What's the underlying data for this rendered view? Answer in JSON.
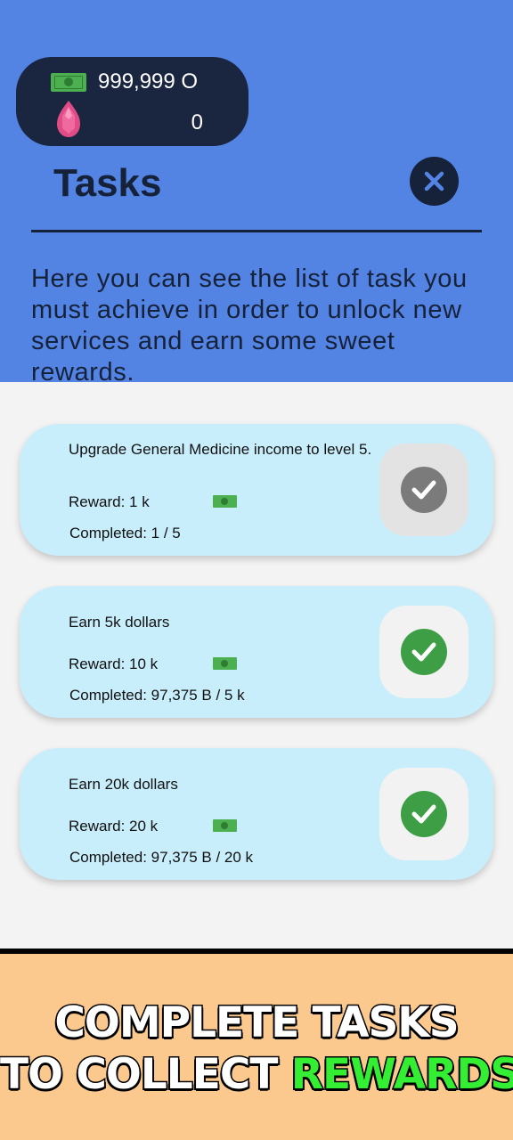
{
  "currency": {
    "cash": "999,999 O",
    "gems": "0"
  },
  "header": {
    "title": "Tasks",
    "description": "Here you can see the list of task you must achieve in order to unlock new services and earn some sweet rewards."
  },
  "tasks": [
    {
      "title": "Upgrade General Medicine income to level 5.",
      "reward": "Reward: 1 k",
      "completed": "Completed:  1 / 5",
      "status": "pending"
    },
    {
      "title": "Earn 5k dollars",
      "reward": "Reward: 10 k",
      "completed": "Completed:  97,375 B / 5 k",
      "status": "done"
    },
    {
      "title": "Earn 20k dollars",
      "reward": "Reward: 20 k",
      "completed": "Completed:  97,375 B / 20 k",
      "status": "done"
    }
  ],
  "banner": {
    "line1": "COMPLETE TASKS",
    "line2_part1": "TO COLLECT",
    "line2_part2": "REWARDS"
  },
  "colors": {
    "header_bg": "#5384e3",
    "panel_bg": "#1a2540",
    "card_bg": "#c9eefb",
    "done_check": "#3e9e45",
    "pending_check": "#7b7b7b",
    "banner_bg": "#fbc98e",
    "banner_accent": "#33ee33"
  },
  "icons": {
    "cash": "cash-icon",
    "gem": "gem-icon",
    "close": "close-icon",
    "check": "check-icon"
  }
}
